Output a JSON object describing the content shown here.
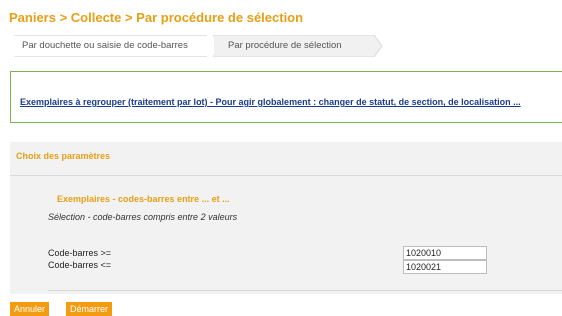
{
  "breadcrumb": "Paniers > Collecte > Par procédure de sélection",
  "tabs": [
    {
      "label": "Par douchette ou saisie de code-barres"
    },
    {
      "label": "Par procédure de sélection"
    }
  ],
  "notice": {
    "link_text": "Exemplaires à regrouper (traitement par lot) - Pour agir globalement : changer de statut, de section, de localisation ..."
  },
  "panel": {
    "title": "Choix des paramètres",
    "section_title": "Exemplaires - codes-barres entre ... et ...",
    "section_desc": "Sélection - code-barres compris entre 2 valeurs",
    "fields": [
      {
        "label": "Code-barres >=",
        "value": "1020010"
      },
      {
        "label": "Code-barres <=",
        "value": "1020021"
      }
    ]
  },
  "buttons": {
    "cancel": "Annuler",
    "start": "Démarrer"
  },
  "colors": {
    "accent": "#e6a016",
    "button": "#f39c12",
    "link": "#1a3d8f",
    "notice_border": "#7fb34c"
  }
}
